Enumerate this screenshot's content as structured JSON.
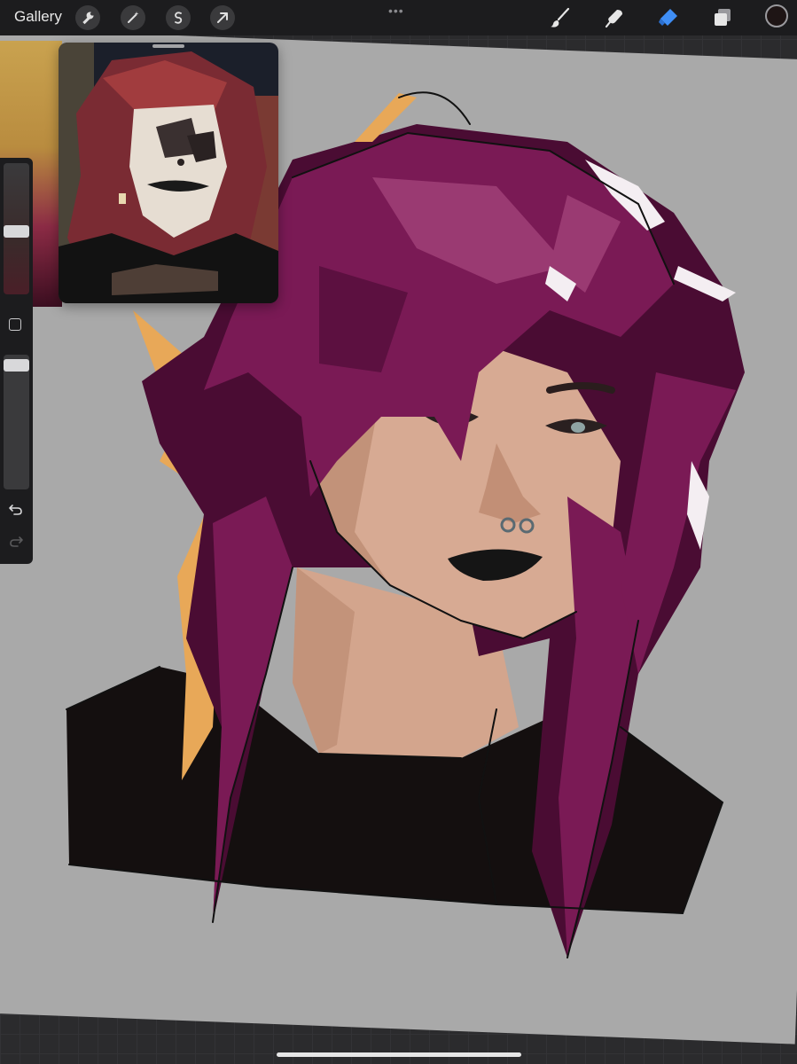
{
  "toolbar": {
    "gallery_label": "Gallery",
    "left_tools": [
      "wrench-icon",
      "magic-wand-icon",
      "selection-icon",
      "transform-arrow-icon"
    ],
    "more_label": "•••",
    "right_tools": [
      "brush-icon",
      "smudge-icon",
      "eraser-icon",
      "layers-icon"
    ],
    "active_tool": "eraser-icon",
    "active_color": "#1e1515",
    "accent": "#3f8ef5"
  },
  "sidebar": {
    "size_slider_value": 0.62,
    "opacity_slider_value": 0.06,
    "modify_button": "square-modify-icon",
    "undo": "undo-icon",
    "redo": "redo-icon"
  },
  "reference": {
    "colors": {
      "hair": "#7a2b33",
      "hair_highlight": "#a13c3e",
      "face": "#e6ddd2",
      "shirt": "#121212",
      "background": "#1b1f2a"
    }
  },
  "artwork": {
    "palette": {
      "hair_dark": "#4a0c33",
      "hair_mid": "#7a1a55",
      "hair_light": "#9a3a72",
      "hair_shine": "#f4eef2",
      "hair_edge": "#e8a858",
      "skin": "#d7aa93",
      "skin_shadow": "#b9876e",
      "lips": "#151515",
      "shirt": "#140f0f",
      "canvas": "#a9a9a9"
    }
  }
}
